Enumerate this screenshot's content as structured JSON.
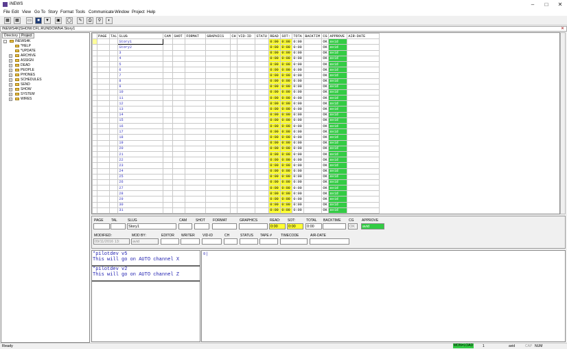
{
  "app": {
    "title": "iNEWS",
    "menu": [
      "File",
      "Edit",
      "View",
      "Go To",
      "Story",
      "Format",
      "Tools",
      "Communicate",
      "Window",
      "Project",
      "Help"
    ]
  },
  "path": "INEWS4K|SHOW.CFL.RUNDOWN4.Story1",
  "nav": {
    "tabs": [
      "Directory",
      "Project"
    ],
    "root": "INEWS4K",
    "items": [
      "*HELP",
      "*UPDATE",
      "ARCHIVE",
      "ASSIGN",
      "DEAD",
      "PEOPLE",
      "PHONES",
      "SCHEDULES",
      "SEND",
      "SHOW",
      "SYSTEM",
      "WIRES"
    ]
  },
  "grid": {
    "headers": [
      "PAGE",
      "TAL",
      "SLUG",
      "CAM",
      "SHOT",
      "FORMAT",
      "GRAPHICS",
      "CH",
      "VID-ID",
      "STATU",
      "READ",
      "SOT:",
      "TOTA",
      "BACKTIM",
      "CG",
      "APPROVE",
      "AIR-DATE"
    ],
    "slugs": [
      "Story1",
      "Story2",
      "3",
      "4",
      "5",
      "6",
      "7",
      "8",
      "9",
      "10",
      "11",
      "12",
      "13",
      "14",
      "15",
      "16",
      "17",
      "18",
      "19",
      "20",
      "21",
      "22",
      "23",
      "24",
      "25",
      "26",
      "27",
      "28",
      "29",
      "30",
      "31"
    ],
    "read": "0:00",
    "sot": "0:00",
    "total": "0:00",
    "cg": "OK",
    "approve": "avid"
  },
  "form": {
    "labels": {
      "page": "PAGE",
      "tal": "TAL",
      "slug": "SLUG",
      "cam": "CAM",
      "shot": "SHOT",
      "format": "FORMAT",
      "graphics": "GRAPHICS",
      "read": "READ:",
      "sot": "SOT:",
      "total": "TOTAL",
      "backtime": "BACKTIME",
      "cg": "CG",
      "approve": "APPROVE",
      "airdate": "AIR-DATE",
      "modified": "MODIFIED:",
      "modby": "MOD BY:",
      "editor": "EDITOR",
      "writer": "WRITER",
      "vidid": "VID-ID",
      "ch": "CH",
      "status": "STATUS",
      "tape": "TAPE #",
      "timecode": "TIMECODE",
      "airdate2": "AIR-DATE"
    },
    "values": {
      "slug": "Story1",
      "read": "0:00",
      "sot": "0:00",
      "total": "0:00",
      "cg": "OK",
      "approve": "avid",
      "modified": "09/11/2016 13:",
      "modby": "avid"
    }
  },
  "cg": [
    {
      "line1": "*pilotdev v5",
      "line2": "This will go on AUTO channel X"
    },
    {
      "line1": "*pilotdev v2",
      "line2": "This will go on AUTO channel Z"
    }
  ],
  "script": {
    "caret": "¤|"
  },
  "status": {
    "ready": "Ready",
    "mode": "MON=LOAD",
    "page": "1",
    "user": "avid",
    "cap": "CAP",
    "num": "NUM"
  }
}
